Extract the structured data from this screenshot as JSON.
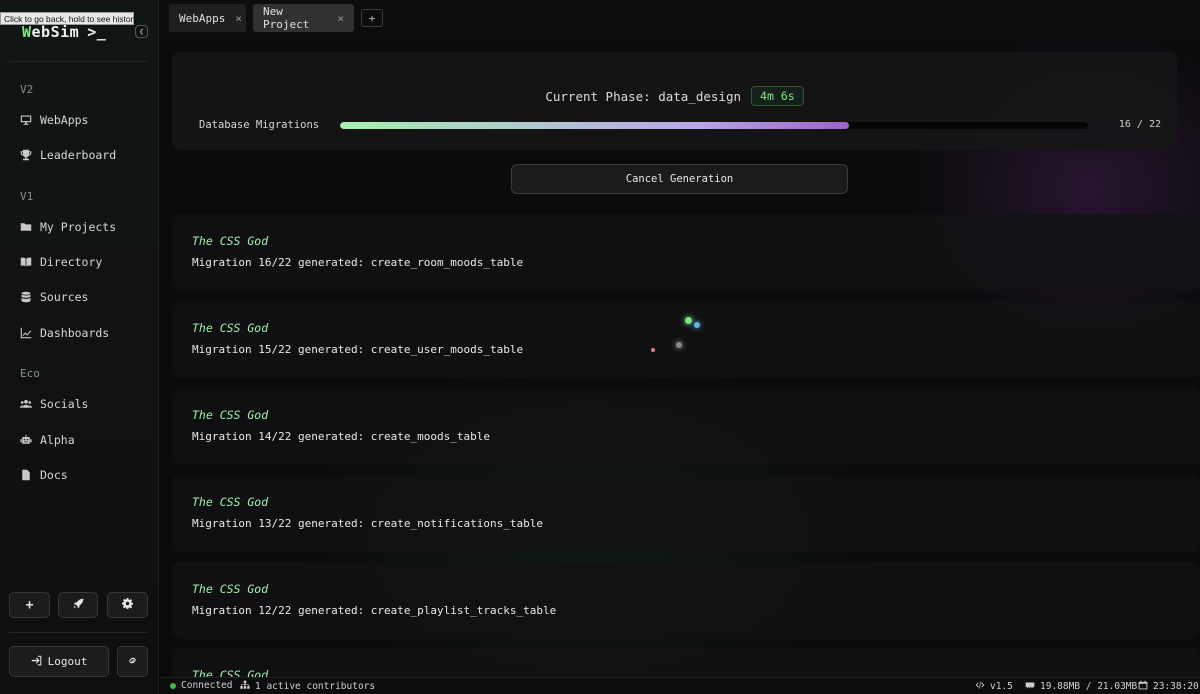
{
  "tooltip": "Click to go back, hold to see history",
  "brand": {
    "w": "W",
    "rest": "ebSim",
    "prompt": ">_"
  },
  "sidebar": {
    "sections": [
      {
        "label": "V2",
        "items": [
          {
            "label": "WebApps",
            "icon": "monitor-icon"
          },
          {
            "label": "Leaderboard",
            "icon": "trophy-icon"
          }
        ]
      },
      {
        "label": "V1",
        "items": [
          {
            "label": "My Projects",
            "icon": "folder-icon"
          },
          {
            "label": "Directory",
            "icon": "book-icon"
          },
          {
            "label": "Sources",
            "icon": "database-icon"
          },
          {
            "label": "Dashboards",
            "icon": "chart-icon"
          }
        ]
      },
      {
        "label": "Eco",
        "items": [
          {
            "label": "Socials",
            "icon": "users-icon"
          },
          {
            "label": "Alpha",
            "icon": "robot-icon"
          },
          {
            "label": "Docs",
            "icon": "file-icon"
          }
        ]
      }
    ],
    "bottom": {
      "add": "+",
      "logout": "Logout"
    }
  },
  "tabs": [
    {
      "label": "WebApps",
      "close": "×",
      "active": false
    },
    {
      "label": "New Project",
      "close": "×",
      "active": true
    }
  ],
  "tab_add": "+",
  "phase": {
    "title": "Current Phase: data_design",
    "timer": "4m 6s",
    "progress_label": "Database Migrations",
    "progress_value": 0.68,
    "count": "16 / 22"
  },
  "cancel_label": "Cancel Generation",
  "logs": [
    {
      "author": "The CSS God",
      "message": "Migration 16/22 generated: create_room_moods_table"
    },
    {
      "author": "The CSS God",
      "message": "Migration 15/22 generated: create_user_moods_table"
    },
    {
      "author": "The CSS God",
      "message": "Migration 14/22 generated: create_moods_table"
    },
    {
      "author": "The CSS God",
      "message": "Migration 13/22 generated: create_notifications_table"
    },
    {
      "author": "The CSS God",
      "message": "Migration 12/22 generated: create_playlist_tracks_table"
    },
    {
      "author": "The CSS God",
      "message": ""
    }
  ],
  "status": {
    "connected": "Connected",
    "contributors": "1 active contributors",
    "version": "v1.5",
    "memory": "19.88MB / 21.03MB",
    "time": "23:38:20"
  },
  "colors": {
    "accent_green": "#7ee787",
    "progress_end": "#9a64c8"
  }
}
